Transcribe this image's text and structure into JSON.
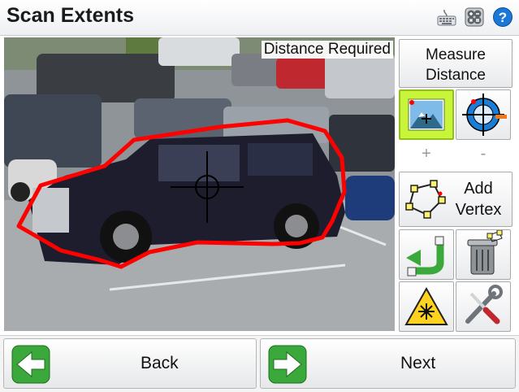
{
  "header": {
    "title": "Scan Extents",
    "icons": [
      "keyboard-icon",
      "calculator-icon",
      "help-icon"
    ]
  },
  "viewport": {
    "overlay_label": "Distance Required"
  },
  "panel": {
    "measure_label_line1": "Measure",
    "measure_label_line2": "Distance",
    "zoom_in_label": "+",
    "zoom_out_label": "-",
    "add_vertex_line1": "Add",
    "add_vertex_line2": "Vertex"
  },
  "footer": {
    "back_label": "Back",
    "next_label": "Next"
  },
  "colors": {
    "polygon": "#ff0000",
    "accent_green": "#3aa83a",
    "active_button": "#c8f53a",
    "help_blue": "#1a78d6"
  }
}
